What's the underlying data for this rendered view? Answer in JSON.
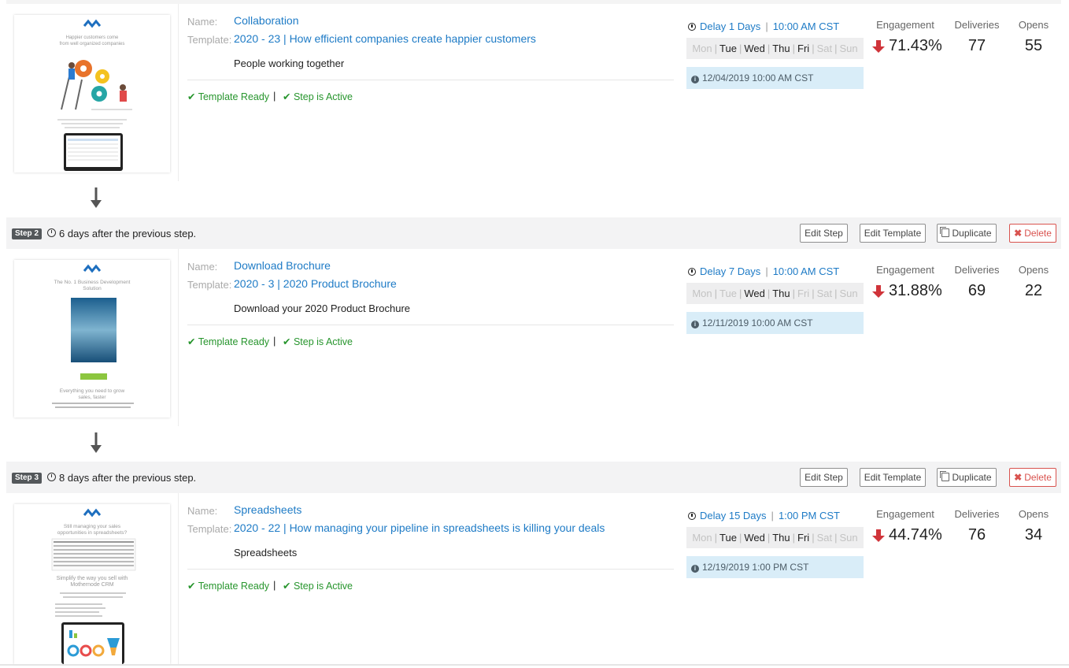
{
  "labels": {
    "name": "Name:",
    "template": "Template:",
    "engagement": "Engagement",
    "deliveries": "Deliveries",
    "opens": "Opens",
    "template_ready": "Template Ready",
    "step_active": "Step is Active",
    "separator": "|",
    "edit_step": "Edit Step",
    "edit_template": "Edit Template",
    "duplicate": "Duplicate",
    "delete": "Delete"
  },
  "colors": {
    "link": "#1e7bc6",
    "success": "#27952d",
    "danger": "#d9534f",
    "info_bg": "#d9edf8",
    "trend_down": "#d0343a"
  },
  "steps": [
    {
      "badge": "",
      "header_text": "",
      "name": "Collaboration",
      "template": "2020 - 23 | How efficient companies create happier customers",
      "description": "People working together",
      "delay": "Delay 1 Days",
      "time": "10:00 AM CST",
      "days": [
        {
          "d": "Mon",
          "on": false
        },
        {
          "d": "Tue",
          "on": true
        },
        {
          "d": "Wed",
          "on": true
        },
        {
          "d": "Thu",
          "on": true
        },
        {
          "d": "Fri",
          "on": true
        },
        {
          "d": "Sat",
          "on": false
        },
        {
          "d": "Sun",
          "on": false
        }
      ],
      "next_send": "12/04/2019 10:00 AM CST",
      "engagement": "71.43%",
      "engagement_trend": "down",
      "deliveries": "77",
      "opens": "55",
      "thumb_lines": [
        "Happier customers come",
        "from well organized companies"
      ]
    },
    {
      "badge": "Step 2",
      "header_text": "6 days after the previous step.",
      "name": "Download Brochure",
      "template": "2020 - 3 | 2020 Product Brochure",
      "description": "Download your 2020 Product Brochure",
      "delay": "Delay 7 Days",
      "time": "10:00 AM CST",
      "days": [
        {
          "d": "Mon",
          "on": false
        },
        {
          "d": "Tue",
          "on": false
        },
        {
          "d": "Wed",
          "on": true
        },
        {
          "d": "Thu",
          "on": true
        },
        {
          "d": "Fri",
          "on": false
        },
        {
          "d": "Sat",
          "on": false
        },
        {
          "d": "Sun",
          "on": false
        }
      ],
      "next_send": "12/11/2019 10:00 AM CST",
      "engagement": "31.88%",
      "engagement_trend": "down",
      "deliveries": "69",
      "opens": "22",
      "thumb_lines": [
        "The No. 1 Business Development",
        "Solution",
        "Everything you need to grow",
        "sales, faster"
      ]
    },
    {
      "badge": "Step 3",
      "header_text": "8 days after the previous step.",
      "name": "Spreadsheets",
      "template": "2020 - 22 | How managing your pipeline in spreadsheets is killing your deals",
      "description": "Spreadsheets",
      "delay": "Delay 15 Days",
      "time": "1:00 PM CST",
      "days": [
        {
          "d": "Mon",
          "on": false
        },
        {
          "d": "Tue",
          "on": true
        },
        {
          "d": "Wed",
          "on": true
        },
        {
          "d": "Thu",
          "on": true
        },
        {
          "d": "Fri",
          "on": true
        },
        {
          "d": "Sat",
          "on": false
        },
        {
          "d": "Sun",
          "on": false
        }
      ],
      "next_send": "12/19/2019 1:00 PM CST",
      "engagement": "44.74%",
      "engagement_trend": "down",
      "deliveries": "76",
      "opens": "34",
      "thumb_lines": [
        "Still managing your sales",
        "opportunities in spreadsheets?",
        "Simplify the way you sell with",
        "Mothernode CRM"
      ]
    }
  ]
}
